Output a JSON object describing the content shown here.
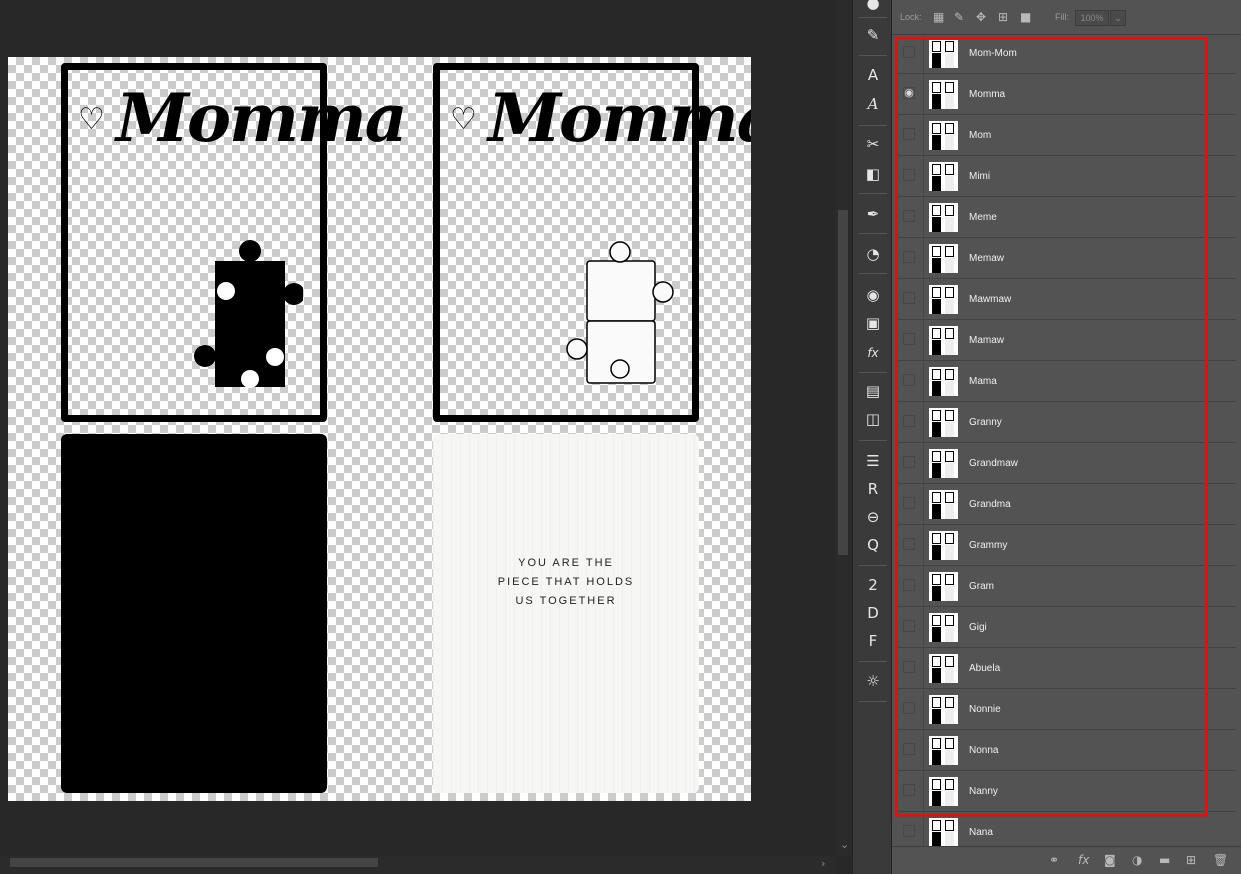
{
  "canvas": {
    "card_left": {
      "title": "Momma",
      "heart": "♡"
    },
    "card_right": {
      "title": "Momma",
      "heart": "♡"
    },
    "quote_lines": [
      "YOU ARE THE",
      "PIECE THAT HOLDS",
      "US TOGETHER"
    ]
  },
  "layers_panel": {
    "lock_label": "Lock:",
    "fill_label": "Fill:",
    "fill_value": "100%",
    "layers": [
      {
        "name": "Mom-Mom",
        "visible": false
      },
      {
        "name": "Momma",
        "visible": true
      },
      {
        "name": "Mom",
        "visible": false
      },
      {
        "name": "Mimi",
        "visible": false
      },
      {
        "name": "Meme",
        "visible": false
      },
      {
        "name": "Memaw",
        "visible": false
      },
      {
        "name": "Mawmaw",
        "visible": false
      },
      {
        "name": "Mamaw",
        "visible": false
      },
      {
        "name": "Mama",
        "visible": false
      },
      {
        "name": "Granny",
        "visible": false
      },
      {
        "name": "Grandmaw",
        "visible": false
      },
      {
        "name": "Grandma",
        "visible": false
      },
      {
        "name": "Grammy",
        "visible": false
      },
      {
        "name": "Gram",
        "visible": false
      },
      {
        "name": "Gigi",
        "visible": false
      },
      {
        "name": "Abuela",
        "visible": false
      },
      {
        "name": "Nonnie",
        "visible": false
      },
      {
        "name": "Nonna",
        "visible": false
      },
      {
        "name": "Nanny",
        "visible": false
      },
      {
        "name": "Nana",
        "visible": false
      }
    ]
  },
  "colors": {
    "highlight": "#d01818",
    "panel_bg": "#535353",
    "workspace_bg": "#282828"
  }
}
